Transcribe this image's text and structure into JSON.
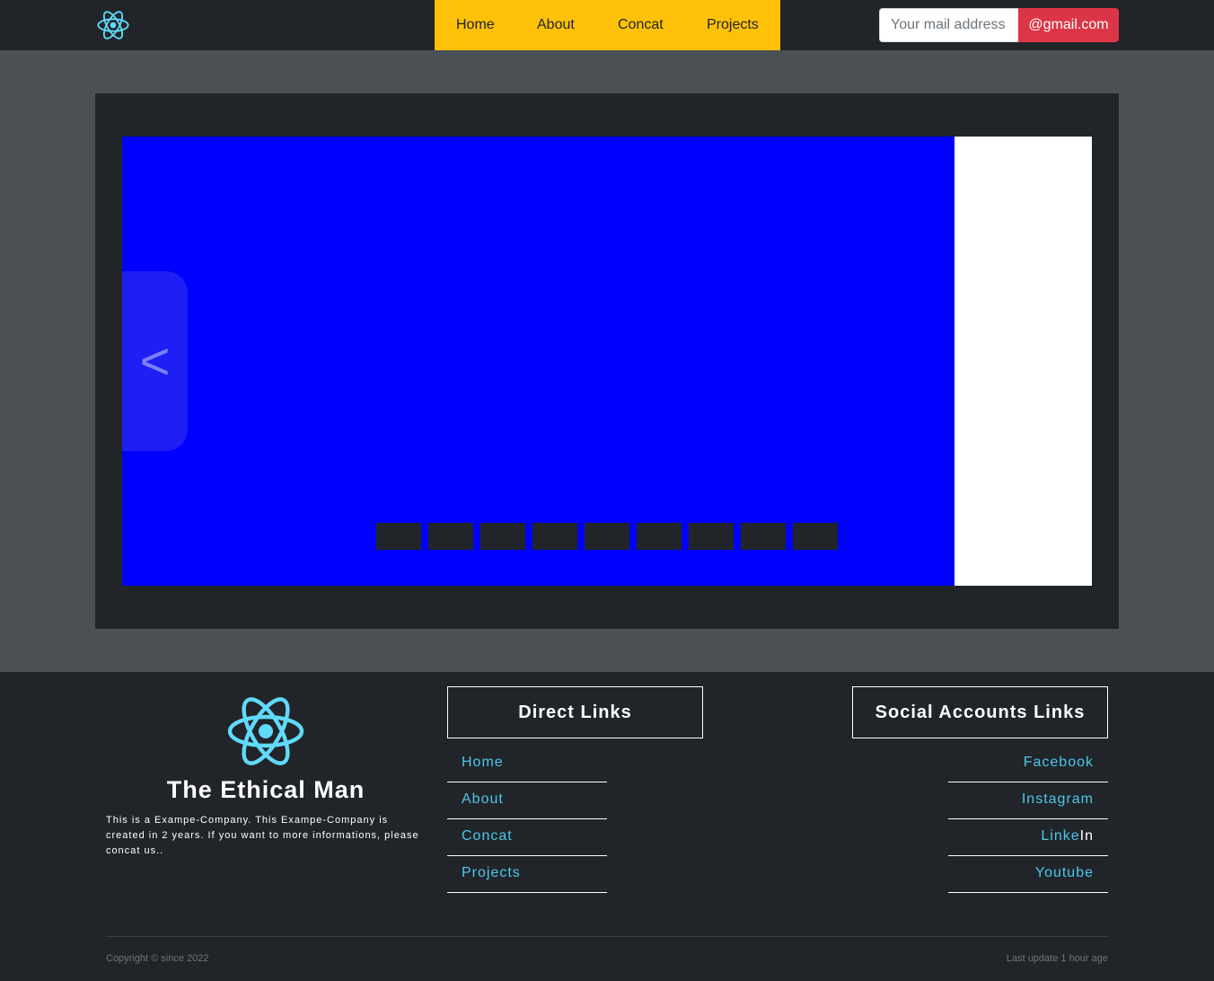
{
  "header": {
    "logo_icon": "react-atom-icon",
    "nav": [
      "Home",
      "About",
      "Concat",
      "Projects"
    ],
    "mail": {
      "placeholder": "Your mail address",
      "suffix": "@gmail.com"
    },
    "colors": {
      "nav_bg": "#ffc107",
      "suffix_bg": "#dc3545"
    }
  },
  "slider": {
    "prev_label": "<",
    "slide_color": "#0000ff",
    "indicator_count": 9
  },
  "footer": {
    "brand": {
      "icon": "react-atom-icon",
      "title": "The Ethical Man",
      "description": "This is a Exampe-Company. This Exampe-Company is created in 2 years. If you want to more informations, please concat us.."
    },
    "direct_links": {
      "title": "Direct Links",
      "items": [
        "Home",
        "About",
        "Concat",
        "Projects"
      ]
    },
    "social_links": {
      "title": "Social Accounts Links",
      "items": [
        "Facebook",
        "Instagram",
        "Linke",
        "Youtube"
      ],
      "linkedin_suffix": "In"
    },
    "copyright": "Copyright © since 2022",
    "last_update": "Last update 1 hour age"
  }
}
